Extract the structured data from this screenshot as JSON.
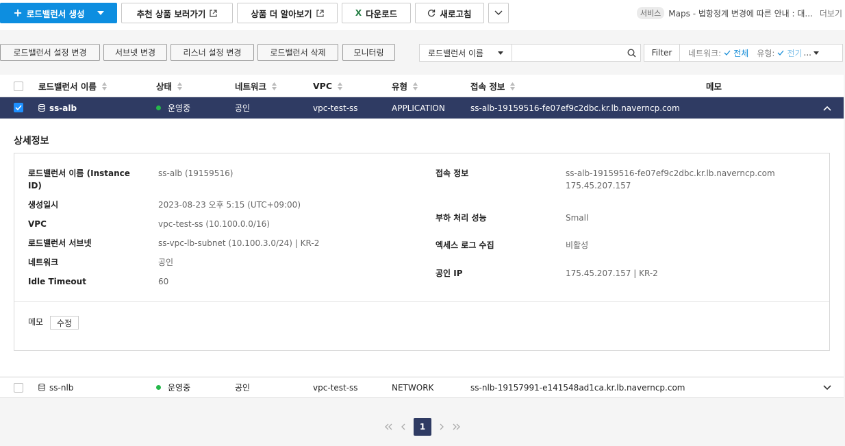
{
  "toolbar": {
    "create_label": "로드밸런서 생성",
    "recommend_label": "추천 상품 보러가기",
    "learn_more_label": "상품 더 알아보기",
    "download_label": "다운로드",
    "refresh_label": "새로고침"
  },
  "notice": {
    "tag": "서비스",
    "text": "Maps - 법항정계 변경에 따른 안내 : 대...",
    "more": "더보기"
  },
  "actions": {
    "edit_settings": "로드밸런서 설정 변경",
    "edit_subnet": "서브넷 변경",
    "edit_listener": "리스너 설정 변경",
    "delete": "로드밸런서 삭제",
    "monitoring": "모니터링"
  },
  "search": {
    "select_value": "로드밸런서 이름",
    "placeholder": ""
  },
  "filter": {
    "label": "Filter",
    "network_label": "네트워크:",
    "network_value": "전체",
    "type_label": "유형:",
    "type_value": "전기"
  },
  "table": {
    "headers": {
      "name": "로드밸런서 이름",
      "status": "상태",
      "network": "네트워크",
      "vpc": "VPC",
      "type": "유형",
      "access": "접속 정보",
      "memo": "메모"
    },
    "rows": [
      {
        "name": "ss-alb",
        "status": "운영중",
        "network": "공인",
        "vpc": "vpc-test-ss",
        "type": "APPLICATION",
        "access": "ss-alb-19159516-fe07ef9c2dbc.kr.lb.naverncp.com"
      },
      {
        "name": "ss-nlb",
        "status": "운영중",
        "network": "공인",
        "vpc": "vpc-test-ss",
        "type": "NETWORK",
        "access": "ss-nlb-19157991-e141548ad1ca.kr.lb.naverncp.com"
      }
    ]
  },
  "detail": {
    "title": "상세정보",
    "left": [
      {
        "label": "로드밸런서 이름 (Instance ID)",
        "value": "ss-alb (19159516)"
      },
      {
        "label": "생성일시",
        "value": "2023-08-23 오후 5:15 (UTC+09:00)"
      },
      {
        "label": "VPC",
        "value": "vpc-test-ss (10.100.0.0/16)"
      },
      {
        "label": "로드밸런서 서브넷",
        "value": "ss-vpc-lb-subnet (10.100.3.0/24) | KR-2"
      },
      {
        "label": "네트워크",
        "value": "공인"
      },
      {
        "label": "Idle Timeout",
        "value": "60"
      }
    ],
    "right": [
      {
        "label": "접속 정보",
        "value": "ss-alb-19159516-fe07ef9c2dbc.kr.lb.naverncp.com",
        "value2": "175.45.207.157"
      },
      {
        "label": "부하 처리 성능",
        "value": "Small"
      },
      {
        "label": "엑세스 로그 수집",
        "value": "비활성"
      },
      {
        "label": "공인 IP",
        "value": "175.45.207.157 | KR-2"
      }
    ],
    "memo_label": "메모",
    "memo_edit": "수정"
  },
  "pagination": {
    "current": "1"
  },
  "colors": {
    "primary": "#0d8ee0",
    "selected_row": "#2f3b63",
    "status_ok": "#25b84a",
    "filter_value": "#1a8fd8"
  }
}
